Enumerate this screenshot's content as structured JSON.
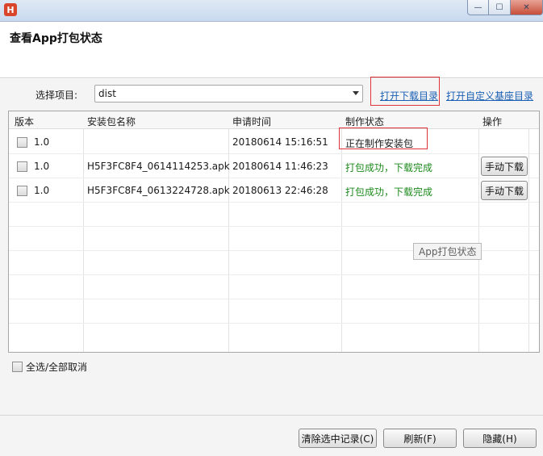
{
  "window": {
    "logo_letter": "H",
    "min_glyph": "—",
    "max_glyph": "☐",
    "close_glyph": "✕"
  },
  "header": {
    "title": "查看App打包状态"
  },
  "project": {
    "label": "选择项目:",
    "selected": "dist"
  },
  "links": {
    "open_download_dir": "打开下载目录",
    "open_custom_base_dir": "打开自定义基座目录"
  },
  "table": {
    "columns": [
      "版本",
      "安装包名称",
      "申请时间",
      "制作状态",
      "操作"
    ],
    "rows": [
      {
        "version": "1.0",
        "package": "",
        "time": "20180614 15:16:51",
        "status": "正在制作安装包",
        "action": ""
      },
      {
        "version": "1.0",
        "package": "H5F3FC8F4_0614114253.apk",
        "time": "20180614 11:46:23",
        "status": "打包成功，下载完成",
        "action": "手动下载"
      },
      {
        "version": "1.0",
        "package": "H5F3FC8F4_0613224728.apk",
        "time": "20180613 22:46:28",
        "status": "打包成功，下载完成",
        "action": "手动下载"
      }
    ]
  },
  "tooltip": "App打包状态",
  "select_all_label": "全选/全部取消",
  "footer": {
    "clear_button": "清除选中记录(C)",
    "refresh_button": "刷新(F)",
    "hide_button": "隐藏(H)"
  },
  "colors": {
    "success": "#1e8a1e",
    "link": "#1a5fb4",
    "highlight": "#e0343a"
  }
}
